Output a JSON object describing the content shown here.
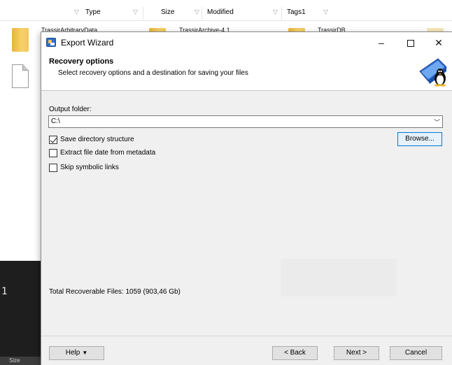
{
  "background": {
    "columns": [
      {
        "label": "Type"
      },
      {
        "label": "Size"
      },
      {
        "label": "Modified"
      },
      {
        "label": "Tags1"
      }
    ],
    "files": [
      "TrassirArbitraryData",
      "TrassirArchive-4.1",
      "TrassirDB"
    ],
    "terminal_text": "1",
    "status_size": "Size"
  },
  "dialog": {
    "title": "Export Wizard",
    "controls": {
      "minimize": "–",
      "close": "✕"
    },
    "header": {
      "title": "Recovery options",
      "subtitle": "Select recovery options and a destination for saving your files"
    },
    "output_folder_label": "Output folder:",
    "output_folder_value": "C:\\",
    "browse_label": "Browse...",
    "options": [
      {
        "label": "Save directory structure",
        "checked": true
      },
      {
        "label": "Extract file date from metadata",
        "checked": false
      },
      {
        "label": "Skip symbolic links",
        "checked": false
      }
    ],
    "total_text": "Total Recoverable Files: 1059 (903,46 Gb)",
    "buttons": {
      "help": "Help",
      "back": "< Back",
      "next": "Next >",
      "cancel": "Cancel"
    }
  },
  "icons": {
    "app": "export-wizard-app-icon",
    "logo": "penguin-drive-logo-icon",
    "folder": "folder-icon",
    "document": "document-icon",
    "filter": "filter-funnel-icon"
  }
}
